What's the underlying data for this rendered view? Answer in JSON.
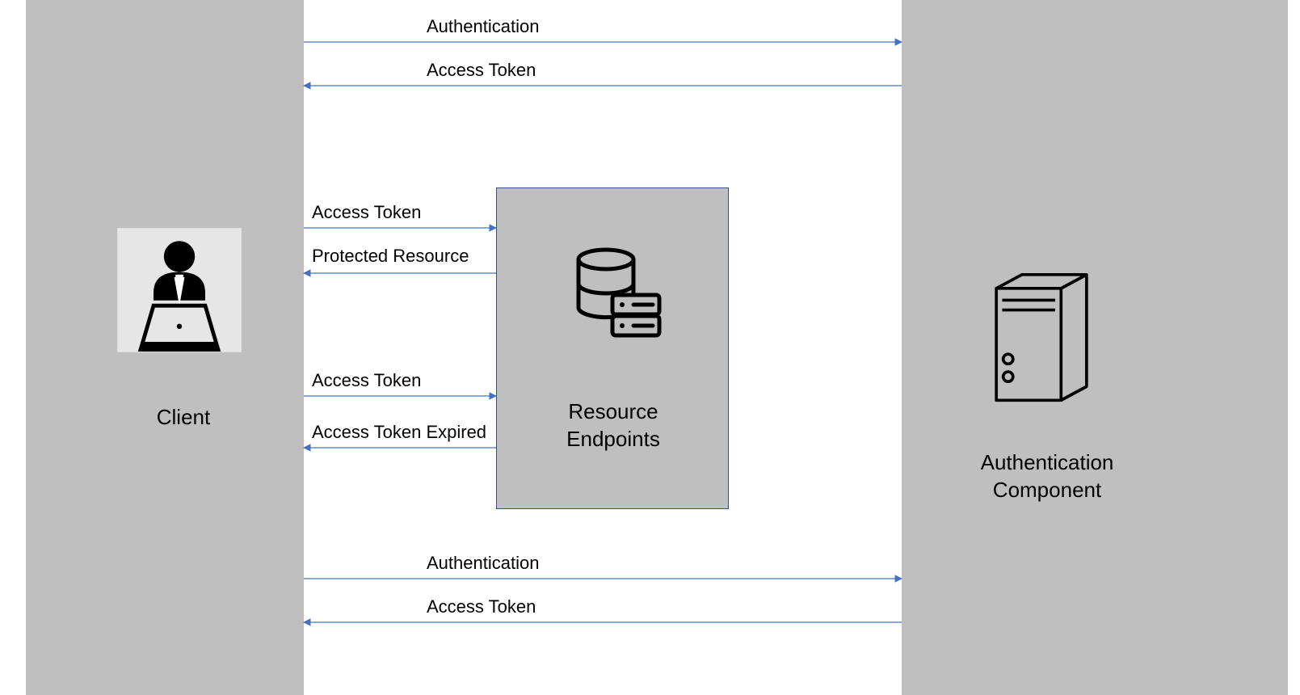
{
  "client_label": "Client",
  "resource_label_line1": "Resource",
  "resource_label_line2": "Endpoints",
  "auth_label_line1": "Authentication",
  "auth_label_line2": "Component",
  "messages": {
    "auth_top": "Authentication",
    "token_top": "Access Token",
    "token_res1": "Access Token",
    "protected_res": "Protected Resource",
    "token_res2": "Access Token",
    "token_expired": "Access Token Expired",
    "auth_bottom": "Authentication",
    "token_bottom": "Access Token"
  }
}
